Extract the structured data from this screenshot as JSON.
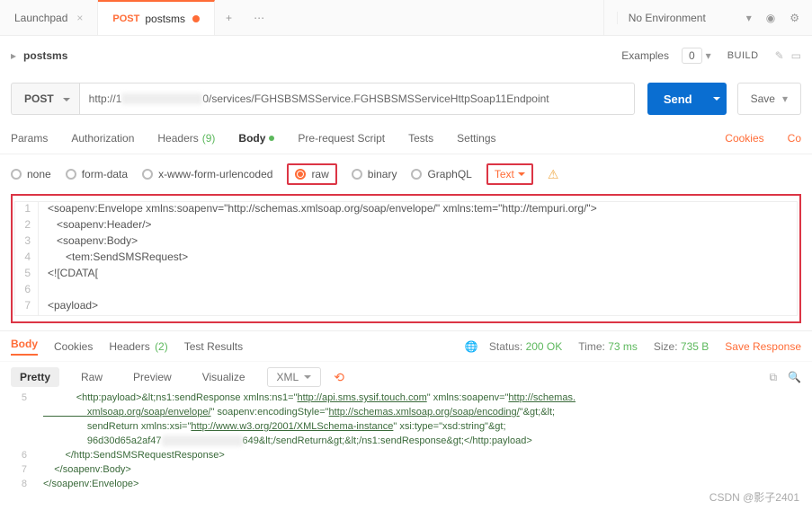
{
  "tabs": {
    "launchpad": "Launchpad",
    "active_method": "POST",
    "active_name": "postsms"
  },
  "environment": {
    "selected": "No Environment"
  },
  "request": {
    "name": "postsms",
    "examples_label": "Examples",
    "examples_count": "0",
    "build_label": "BUILD",
    "method": "POST",
    "url_prefix": "http://1",
    "url_suffix": "0/services/FGHSBSMSService.FGHSBSMSServiceHttpSoap11Endpoint",
    "send_label": "Send",
    "save_label": "Save"
  },
  "reqtabs": {
    "params": "Params",
    "auth": "Authorization",
    "headers": "Headers",
    "headers_count": "(9)",
    "body": "Body",
    "prescript": "Pre-request Script",
    "tests": "Tests",
    "settings": "Settings",
    "cookies": "Cookies",
    "code": "Co"
  },
  "body_types": {
    "none": "none",
    "formdata": "form-data",
    "urlencoded": "x-www-form-urlencoded",
    "raw": "raw",
    "binary": "binary",
    "graphql": "GraphQL",
    "format": "Text"
  },
  "editor_lines": [
    "<soapenv:Envelope xmlns:soapenv=\"http://schemas.xmlsoap.org/soap/envelope/\" xmlns:tem=\"http://tempuri.org/\">",
    "   <soapenv:Header/>",
    "   <soapenv:Body>",
    "      <tem:SendSMSRequest>",
    "<![CDATA[",
    "",
    "<payload>"
  ],
  "response": {
    "tabs": {
      "body": "Body",
      "cookies": "Cookies",
      "headers": "Headers",
      "headers_count": "(2)",
      "tests": "Test Results"
    },
    "status_label": "Status:",
    "status_value": "200 OK",
    "time_label": "Time:",
    "time_value": "73 ms",
    "size_label": "Size:",
    "size_value": "735 B",
    "save_label": "Save Response",
    "view": {
      "pretty": "Pretty",
      "raw": "Raw",
      "preview": "Preview",
      "visualize": "Visualize",
      "format": "XML"
    },
    "lines": {
      "l5_a": "            <http:payload>&lt;ns1:sendResponse xmlns:ns1=\"",
      "l5_u1": "http://api.sms.sysif.touch.com",
      "l5_b": "\" xmlns:soapenv=\"",
      "l5_u2": "http://schemas.",
      "l5_c": "                xmlsoap.org/soap/envelope/",
      "l5_d": "\" soapenv:encodingStyle=\"",
      "l5_u3": "http://schemas.xmlsoap.org/soap/encoding/",
      "l5_e": "\"&gt;&lt;",
      "l5_f": "                sendReturn xmlns:xsi=\"",
      "l5_u4": "http://www.w3.org/2001/XMLSchema-instance",
      "l5_g": "\" xsi:type=\"xsd:string\"&gt;",
      "l5_h": "                96d30d65a2af47",
      "l5_i": "649&lt;/sendReturn&gt;&lt;/ns1:sendResponse&gt;</http:payload>",
      "l6": "        </http:SendSMSRequestResponse>",
      "l7": "    </soapenv:Body>",
      "l8": "</soapenv:Envelope>"
    }
  },
  "watermark": "CSDN @影子2401"
}
